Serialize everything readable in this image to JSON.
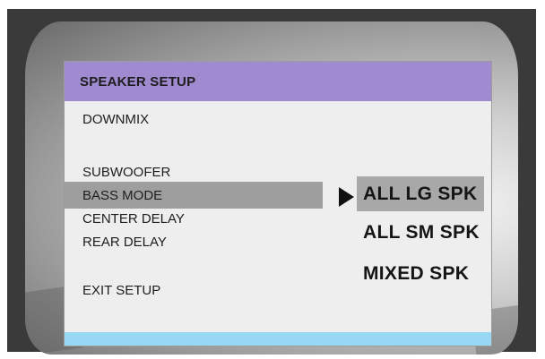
{
  "menu": {
    "title": "SPEAKER SETUP",
    "items": [
      {
        "label": "DOWNMIX"
      },
      {
        "label": "SUBWOOFER"
      },
      {
        "label": "BASS MODE",
        "selected": true
      },
      {
        "label": "CENTER DELAY"
      },
      {
        "label": "REAR DELAY"
      },
      {
        "label": "EXIT SETUP"
      }
    ]
  },
  "options": [
    {
      "label": "ALL LG SPK",
      "highlighted": true
    },
    {
      "label": "ALL SM SPK"
    },
    {
      "label": "MIXED SPK"
    }
  ],
  "icons": {
    "pointer": "right-triangle-pointer-icon"
  },
  "colors": {
    "header": "#a08ad0",
    "footer": "#98d8f4",
    "panel": "#eeeeee",
    "selection": "#9e9e9e"
  }
}
